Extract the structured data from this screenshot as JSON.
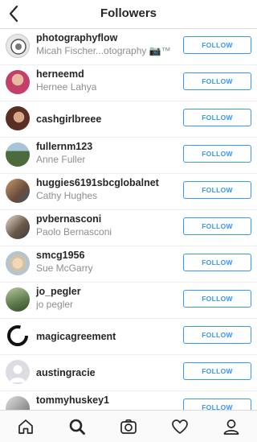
{
  "header": {
    "title": "Followers",
    "back_icon": "chevron-left-icon"
  },
  "followers": [
    {
      "username": "photographyflow",
      "fullname": "Micah Fischer...otography 📷™",
      "button": "FOLLOW",
      "avatar_color": "#bdbdbd"
    },
    {
      "username": "herneemd",
      "fullname": "Hernee Lahya",
      "button": "FOLLOW",
      "avatar_color": "#c2406a"
    },
    {
      "username": "cashgirlbreee",
      "fullname": "",
      "button": "FOLLOW",
      "avatar_color": "#7a4a3a"
    },
    {
      "username": "fullernm123",
      "fullname": "Anne Fuller",
      "button": "FOLLOW",
      "avatar_color": "#4d6b3a"
    },
    {
      "username": "huggies6191sbcglobalnet",
      "fullname": "Cathy Hughes",
      "button": "FOLLOW",
      "avatar_color": "#8a6a4a"
    },
    {
      "username": "pvbernasconi",
      "fullname": "Paolo Bernasconi",
      "button": "FOLLOW",
      "avatar_color": "#6a5a4a"
    },
    {
      "username": "smcg1956",
      "fullname": "Sue McGarry",
      "button": "FOLLOW",
      "avatar_color": "#d9c29a"
    },
    {
      "username": "jo_pegler",
      "fullname": "jo pegler",
      "button": "FOLLOW",
      "avatar_color": "#5a7a4a"
    },
    {
      "username": "magicagreement",
      "fullname": "",
      "button": "FOLLOW",
      "avatar_color": "#222222"
    },
    {
      "username": "austingracie",
      "fullname": "",
      "button": "FOLLOW",
      "avatar_color": "#c7c7cc"
    },
    {
      "username": "tommyhuskey1",
      "fullname": "",
      "button": "FOLLOW",
      "avatar_color": "#9a9a9a"
    }
  ],
  "tabbar": {
    "icons": [
      "home-icon",
      "search-icon",
      "camera-icon",
      "heart-icon",
      "profile-icon"
    ],
    "active": "search-icon"
  }
}
